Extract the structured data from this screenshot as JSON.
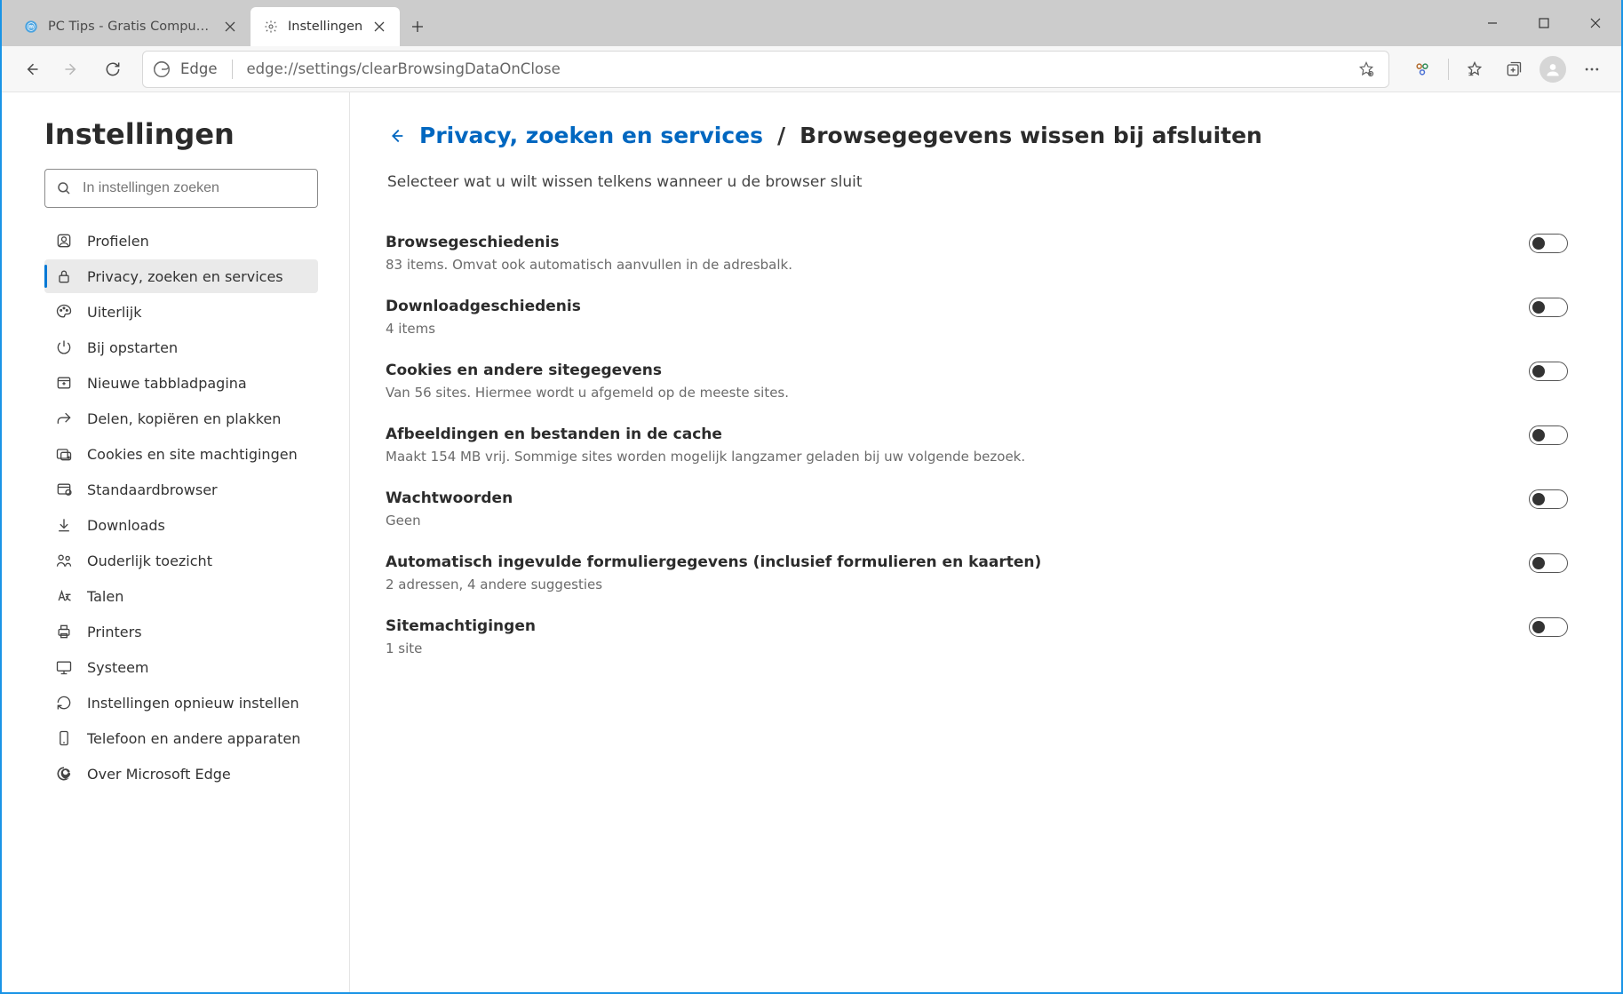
{
  "tabs": [
    {
      "title": "PC Tips - Gratis Computer Tips, i"
    },
    {
      "title": "Instellingen"
    }
  ],
  "address": {
    "label": "Edge",
    "url": "edge://settings/clearBrowsingDataOnClose"
  },
  "sidebar": {
    "heading": "Instellingen",
    "search_placeholder": "In instellingen zoeken",
    "items": [
      {
        "label": "Profielen"
      },
      {
        "label": "Privacy, zoeken en services"
      },
      {
        "label": "Uiterlijk"
      },
      {
        "label": "Bij opstarten"
      },
      {
        "label": "Nieuwe tabbladpagina"
      },
      {
        "label": "Delen, kopiëren en plakken"
      },
      {
        "label": "Cookies en site machtigingen"
      },
      {
        "label": "Standaardbrowser"
      },
      {
        "label": "Downloads"
      },
      {
        "label": "Ouderlijk toezicht"
      },
      {
        "label": "Talen"
      },
      {
        "label": "Printers"
      },
      {
        "label": "Systeem"
      },
      {
        "label": "Instellingen opnieuw instellen"
      },
      {
        "label": "Telefoon en andere apparaten"
      },
      {
        "label": "Over Microsoft Edge"
      }
    ]
  },
  "main": {
    "breadcrumb_link": "Privacy, zoeken en services",
    "breadcrumb_sep": "/",
    "breadcrumb_current": "Browsegegevens wissen bij afsluiten",
    "subtitle": "Selecteer wat u wilt wissen telkens wanneer u de browser sluit",
    "settings": [
      {
        "title": "Browsegeschiedenis",
        "desc": "83 items. Omvat ook automatisch aanvullen in de adresbalk.",
        "on": false
      },
      {
        "title": "Downloadgeschiedenis",
        "desc": "4 items",
        "on": false
      },
      {
        "title": "Cookies en andere sitegegevens",
        "desc": "Van 56 sites. Hiermee wordt u afgemeld op de meeste sites.",
        "on": false
      },
      {
        "title": "Afbeeldingen en bestanden in de cache",
        "desc": "Maakt 154 MB vrij. Sommige sites worden mogelijk langzamer geladen bij uw volgende bezoek.",
        "on": false
      },
      {
        "title": "Wachtwoorden",
        "desc": "Geen",
        "on": false
      },
      {
        "title": "Automatisch ingevulde formuliergegevens (inclusief formulieren en kaarten)",
        "desc": "2 adressen, 4 andere suggesties",
        "on": false
      },
      {
        "title": "Sitemachtigingen",
        "desc": "1 site",
        "on": false
      }
    ]
  }
}
